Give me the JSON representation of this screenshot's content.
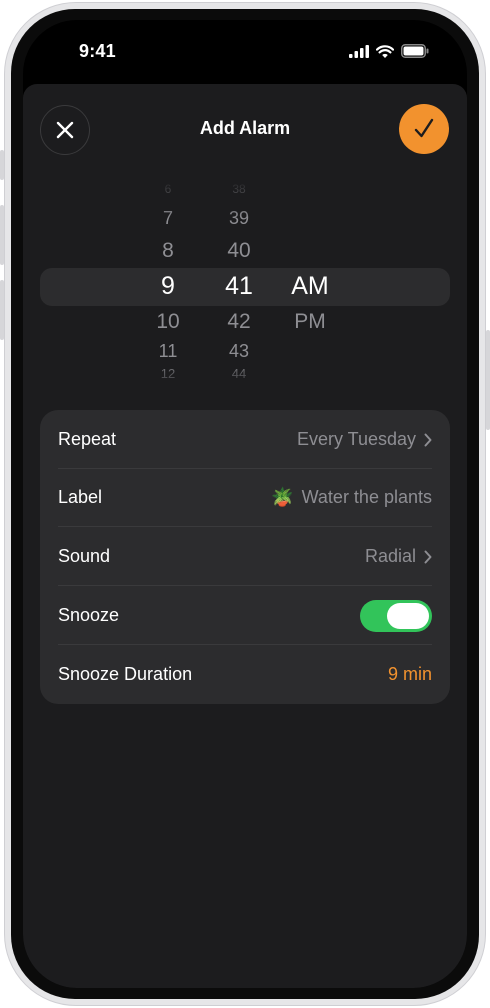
{
  "status_bar": {
    "time": "9:41",
    "icons": [
      "cellular-signal-icon",
      "wifi-icon",
      "battery-icon"
    ]
  },
  "header": {
    "title": "Add Alarm",
    "close_icon": "close-icon",
    "confirm_icon": "checkmark-icon"
  },
  "picker": {
    "hours": [
      "6",
      "7",
      "8",
      "9",
      "10",
      "11",
      "12"
    ],
    "minutes": [
      "38",
      "39",
      "40",
      "41",
      "42",
      "43",
      "44"
    ],
    "periods": [
      "AM",
      "PM"
    ],
    "selected": {
      "hour": "9",
      "minute": "41",
      "period": "AM"
    }
  },
  "settings": {
    "repeat": {
      "label": "Repeat",
      "value": "Every Tuesday"
    },
    "label": {
      "label": "Label",
      "emoji": "🪴",
      "value": "Water the plants"
    },
    "sound": {
      "label": "Sound",
      "value": "Radial"
    },
    "snooze": {
      "label": "Snooze",
      "enabled": true
    },
    "snooze_duration": {
      "label": "Snooze Duration",
      "value": "9 min"
    }
  },
  "colors": {
    "accent": "#f2922e",
    "toggle_on": "#32c45a",
    "sheet_bg": "#1c1c1e",
    "card_bg": "#2c2c2e",
    "secondary_text": "#8e8e93"
  }
}
